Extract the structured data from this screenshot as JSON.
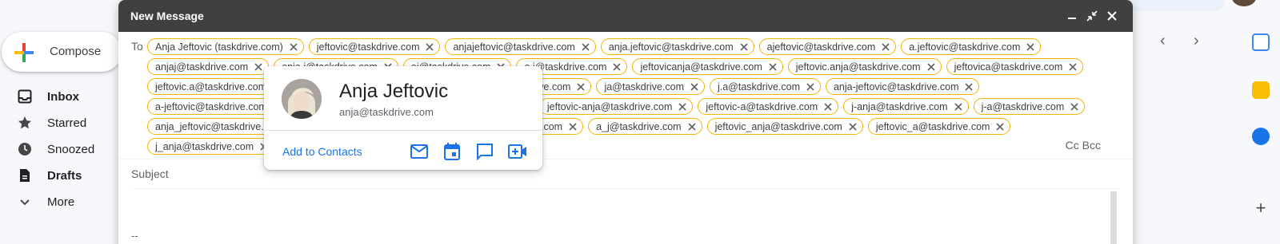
{
  "sidebar": {
    "compose_label": "Compose",
    "items": [
      {
        "label": "Inbox",
        "icon": "inbox-icon",
        "bold": true
      },
      {
        "label": "Starred",
        "icon": "star-icon",
        "bold": false
      },
      {
        "label": "Snoozed",
        "icon": "clock-icon",
        "bold": false
      },
      {
        "label": "Drafts",
        "icon": "draft-icon",
        "bold": true
      },
      {
        "label": "More",
        "icon": "chevron-down-icon",
        "bold": false
      }
    ]
  },
  "compose_window": {
    "title": "New Message",
    "to_label": "To",
    "recipients": [
      "Anja Jeftovic (taskdrive.com)",
      "jeftovic@taskdrive.com",
      "anjajeftovic@taskdrive.com",
      "anja.jeftovic@taskdrive.com",
      "ajeftovic@taskdrive.com",
      "a.jeftovic@taskdrive.com",
      "anjaj@taskdrive.com",
      "anja.j@taskdrive.com",
      "aj@taskdrive.com",
      "a.j@taskdrive.com",
      "jeftovicanja@taskdrive.com",
      "jeftovic.anja@taskdrive.com",
      "jeftovica@taskdrive.com",
      "jeftovic.a@taskdrive.com",
      "jeftovic-anja@taskdrive.com",
      "jeftovic-a@taskdrive.com",
      "ja@taskdrive.com",
      "j.a@taskdrive.com",
      "anja-jeftovic@taskdrive.com",
      "a-jeftovic@taskdrive.com",
      "anja-j@taskdrive.com",
      "a-j@taskdrive.com",
      "jeftovic-anja@taskdrive.com",
      "jeftovic-a@taskdrive.com",
      "j-anja@taskdrive.com",
      "j-a@taskdrive.com",
      "anja_jeftovic@taskdrive.com",
      "a_jeftovic@taskdrive.com",
      "anja_j@taskdrive.com",
      "a_j@taskdrive.com",
      "jeftovic_anja@taskdrive.com",
      "jeftovic_a@taskdrive.com",
      "j_anja@taskdrive.com"
    ],
    "cc_bcc_label": "Cc Bcc",
    "subject_placeholder": "Subject",
    "signature": "--"
  },
  "contact_card": {
    "name": "Anja Jeftovic",
    "email": "anja@taskdrive.com",
    "add_label": "Add to Contacts",
    "actions": [
      "email-icon",
      "calendar-icon",
      "chat-icon",
      "video-call-icon"
    ]
  },
  "colors": {
    "chip_border": "#f4b400",
    "header_bg": "#404040",
    "link": "#1a73e8"
  }
}
